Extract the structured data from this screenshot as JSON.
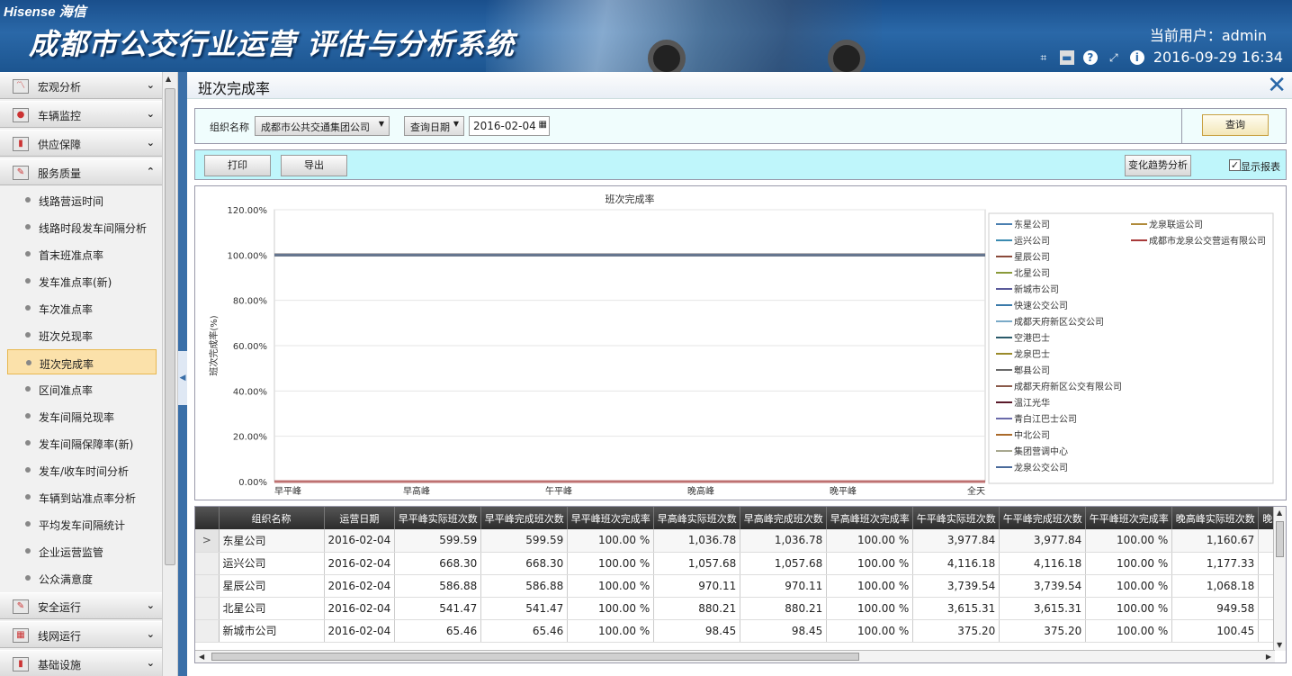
{
  "header": {
    "logo": "Hisense 海信",
    "system_title": "成都市公交行业运营 评估与分析系统",
    "user_label": "当前用户：admin",
    "datetime": "2016-09-29 16:34"
  },
  "sidebar": {
    "categories": [
      {
        "label": "宏观分析",
        "icon": "chart-line-icon",
        "expanded": false
      },
      {
        "label": "车辆监控",
        "icon": "camera-icon",
        "expanded": false
      },
      {
        "label": "供应保障",
        "icon": "bar-chart-icon",
        "expanded": false
      },
      {
        "label": "服务质量",
        "icon": "edit-chart-icon",
        "expanded": true
      }
    ],
    "service_items": [
      "线路营运时间",
      "线路时段发车间隔分析",
      "首末班准点率",
      "发车准点率(新)",
      "车次准点率",
      "班次兑现率",
      "班次完成率",
      "区间准点率",
      "发车间隔兑现率",
      "发车间隔保障率(新)",
      "发车/收车时间分析",
      "车辆到站准点率分析",
      "平均发车间隔统计",
      "企业运营监管",
      "公众满意度"
    ],
    "active_item": "班次完成率",
    "bottom_categories": [
      {
        "label": "安全运行",
        "icon": "shield-chart-icon"
      },
      {
        "label": "线网运行",
        "icon": "network-icon"
      },
      {
        "label": "基础设施",
        "icon": "building-icon"
      }
    ]
  },
  "page": {
    "title": "班次完成率"
  },
  "filters": {
    "org_label": "组织名称",
    "org_value": "成都市公共交通集团公司",
    "date_type_value": "查询日期",
    "date_value": "2016-02-04",
    "query_button": "查询"
  },
  "toolbar": {
    "print_button": "打印",
    "export_button": "导出",
    "trend_button": "变化趋势分析",
    "show_report_label": "显示报表",
    "show_report_checked": true
  },
  "chart_data": {
    "type": "line",
    "title": "班次完成率",
    "xlabel": "",
    "ylabel": "班次完成率(%)",
    "categories": [
      "早平峰",
      "早高峰",
      "午平峰",
      "晚高峰",
      "晚平峰",
      "全天"
    ],
    "ylim": [
      0,
      120
    ],
    "y_ticks": [
      "0.00%",
      "20.00%",
      "40.00%",
      "60.00%",
      "80.00%",
      "100.00%",
      "120.00%"
    ],
    "grid": true,
    "legend_placement": "right",
    "series": [
      {
        "name": "东星公司",
        "color": "#4a7fb0",
        "values": [
          100,
          100,
          100,
          100,
          100,
          100
        ]
      },
      {
        "name": "龙泉联运公司",
        "color": "#b08a3a",
        "values": [
          100,
          100,
          100,
          100,
          100,
          100
        ]
      },
      {
        "name": "运兴公司",
        "color": "#3a8ab0",
        "values": [
          100,
          100,
          100,
          100,
          100,
          100
        ]
      },
      {
        "name": "成都市龙泉公交营运有限公司",
        "color": "#a83a3a",
        "values": [
          0,
          0,
          0,
          0,
          0,
          0
        ]
      },
      {
        "name": "星辰公司",
        "color": "#8a4a3a",
        "values": [
          100,
          100,
          100,
          100,
          100,
          100
        ]
      },
      {
        "name": "北星公司",
        "color": "#8a9a3a",
        "values": [
          100,
          100,
          100,
          100,
          100,
          100
        ]
      },
      {
        "name": "新城市公司",
        "color": "#5a5a9a",
        "values": [
          100,
          100,
          100,
          100,
          100,
          100
        ]
      },
      {
        "name": "快速公交公司",
        "color": "#3a7aaa",
        "values": [
          100,
          100,
          100,
          100,
          100,
          100
        ]
      },
      {
        "name": "成都天府新区公交公司",
        "color": "#7aaac8",
        "values": [
          100,
          100,
          100,
          100,
          100,
          100
        ]
      },
      {
        "name": "空港巴士",
        "color": "#2a5a6a",
        "values": [
          100,
          100,
          100,
          100,
          100,
          100
        ]
      },
      {
        "name": "龙泉巴士",
        "color": "#9a8a2a",
        "values": [
          100,
          100,
          100,
          100,
          100,
          100
        ]
      },
      {
        "name": "郫县公司",
        "color": "#6a6a6a",
        "values": [
          100,
          100,
          100,
          100,
          100,
          100
        ]
      },
      {
        "name": "成都天府新区公交有限公司",
        "color": "#8a5a4a",
        "values": [
          100,
          100,
          100,
          100,
          100,
          100
        ]
      },
      {
        "name": "温江光华",
        "color": "#5a1a2a",
        "values": [
          100,
          100,
          100,
          100,
          100,
          100
        ]
      },
      {
        "name": "青白江巴士公司",
        "color": "#6a6aaa",
        "values": [
          100,
          100,
          100,
          100,
          100,
          100
        ]
      },
      {
        "name": "中北公司",
        "color": "#aa6a2a",
        "values": [
          100,
          100,
          100,
          100,
          100,
          100
        ]
      },
      {
        "name": "集团营调中心",
        "color": "#a8a890",
        "values": [
          100,
          100,
          100,
          100,
          100,
          100
        ]
      },
      {
        "name": "龙泉公交公司",
        "color": "#4a6a9a",
        "values": [
          100,
          100,
          100,
          100,
          100,
          100
        ]
      }
    ]
  },
  "table": {
    "columns": [
      "组织名称",
      "运营日期",
      "早平峰实际班次数",
      "早平峰完成班次数",
      "早平峰班次完成率",
      "早高峰实际班次数",
      "早高峰完成班次数",
      "早高峰班次完成率",
      "午平峰实际班次数",
      "午平峰完成班次数",
      "午平峰班次完成率",
      "晚高峰实际班次数",
      "晚"
    ],
    "rows": [
      [
        "东星公司",
        "2016-02-04",
        "599.59",
        "599.59",
        "100.00 %",
        "1,036.78",
        "1,036.78",
        "100.00 %",
        "3,977.84",
        "3,977.84",
        "100.00 %",
        "1,160.67",
        ""
      ],
      [
        "运兴公司",
        "2016-02-04",
        "668.30",
        "668.30",
        "100.00 %",
        "1,057.68",
        "1,057.68",
        "100.00 %",
        "4,116.18",
        "4,116.18",
        "100.00 %",
        "1,177.33",
        ""
      ],
      [
        "星辰公司",
        "2016-02-04",
        "586.88",
        "586.88",
        "100.00 %",
        "970.11",
        "970.11",
        "100.00 %",
        "3,739.54",
        "3,739.54",
        "100.00 %",
        "1,068.18",
        ""
      ],
      [
        "北星公司",
        "2016-02-04",
        "541.47",
        "541.47",
        "100.00 %",
        "880.21",
        "880.21",
        "100.00 %",
        "3,615.31",
        "3,615.31",
        "100.00 %",
        "949.58",
        ""
      ],
      [
        "新城市公司",
        "2016-02-04",
        "65.46",
        "65.46",
        "100.00 %",
        "98.45",
        "98.45",
        "100.00 %",
        "375.20",
        "375.20",
        "100.00 %",
        "100.45",
        ""
      ]
    ],
    "current_row_marker": ">"
  }
}
